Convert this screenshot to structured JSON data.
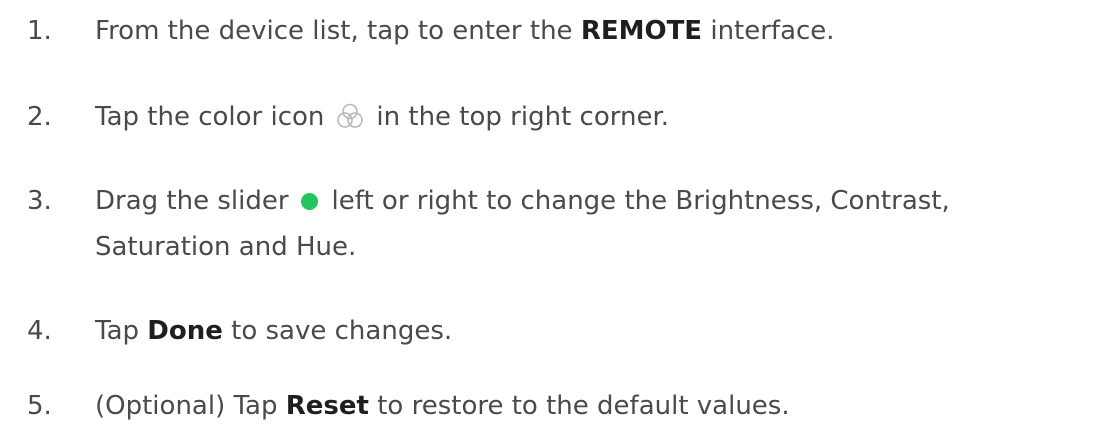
{
  "steps": [
    {
      "number": "1.",
      "text_before": "From the device list, tap to enter the ",
      "bold": "REMOTE",
      "text_after": " interface."
    },
    {
      "number": "2.",
      "text_before": "Tap the color icon",
      "icon": "color-circles-icon",
      "text_after": "in the top right corner."
    },
    {
      "number": "3.",
      "text_before": "Drag the slider",
      "icon": "slider-handle-icon",
      "text_after": "left or right to change the Brightness, Contrast,",
      "text_line2": "Saturation and Hue."
    },
    {
      "number": "4.",
      "text_before": "Tap ",
      "bold": "Done",
      "text_after": " to save changes."
    },
    {
      "number": "5.",
      "text_before": "(Optional) Tap ",
      "bold": "Reset",
      "text_after": " to restore to the default values."
    }
  ],
  "colors": {
    "text": "#4a4a4a",
    "bold_text": "#1f1f1f",
    "slider_handle": "#22c55e",
    "icon_stroke": "#b8b8b8"
  }
}
